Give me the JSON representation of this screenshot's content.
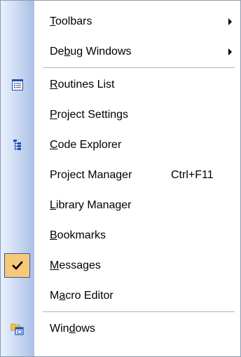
{
  "menu": {
    "items": [
      {
        "pre": "",
        "u": "T",
        "post": "oolbars",
        "submenu": true
      },
      {
        "pre": "De",
        "u": "b",
        "post": "ug Windows",
        "submenu": true
      },
      {
        "separator": true
      },
      {
        "pre": "",
        "u": "R",
        "post": "outines List",
        "icon": "routines-list-icon"
      },
      {
        "pre": "",
        "u": "P",
        "post": "roject Settings"
      },
      {
        "pre": "",
        "u": "C",
        "post": "ode Explorer",
        "icon": "code-explorer-icon"
      },
      {
        "pre": "Pro",
        "u": "j",
        "post": "ect Manager",
        "shortcut": "Ctrl+F11"
      },
      {
        "pre": "",
        "u": "L",
        "post": "ibrary Manager"
      },
      {
        "pre": "",
        "u": "B",
        "post": "ookmarks"
      },
      {
        "pre": "",
        "u": "M",
        "post": "essages",
        "checked": true,
        "icon": "checkmark-icon"
      },
      {
        "pre": "M",
        "u": "a",
        "post": "cro Editor"
      },
      {
        "separator": true
      },
      {
        "pre": "Win",
        "u": "d",
        "post": "ows",
        "icon": "windows-icon"
      }
    ]
  },
  "colors": {
    "check_highlight": "#f7c878",
    "check_border": "#3a57a8",
    "icon_blue": "#1a4fb4",
    "separator": "#a5b6d2"
  }
}
